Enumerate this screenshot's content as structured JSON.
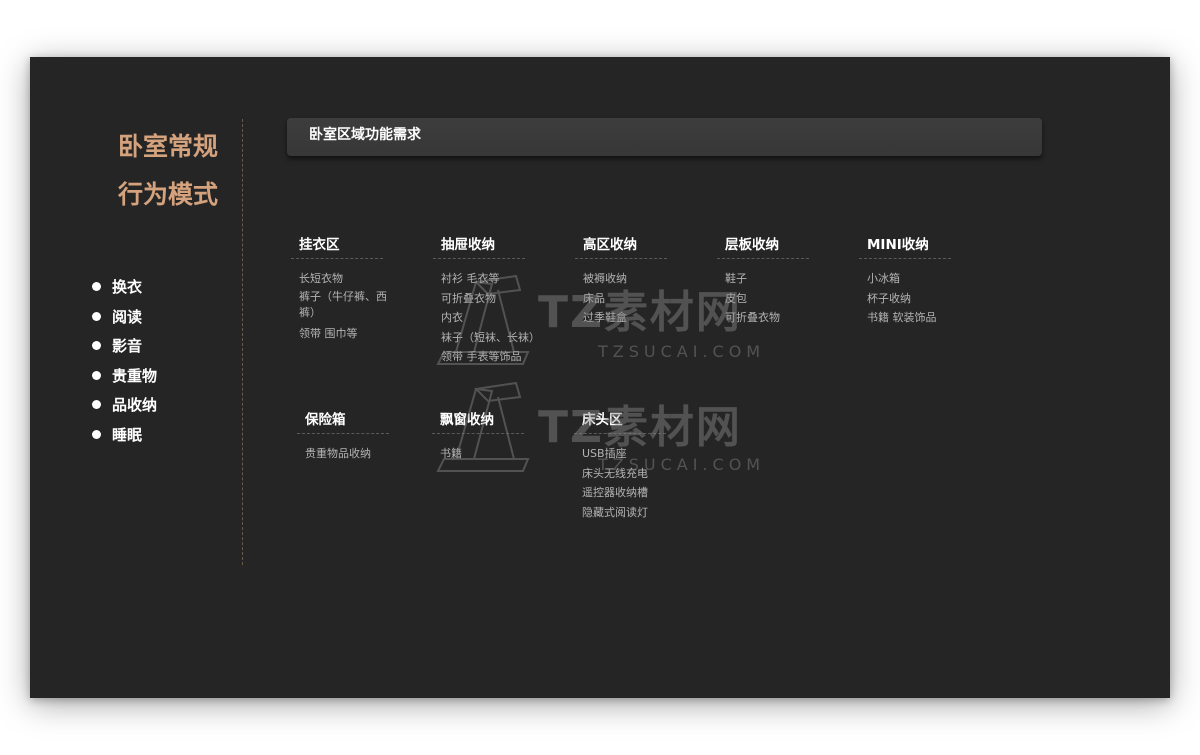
{
  "sidebar": {
    "title_line1": "卧室常规",
    "title_line2": "行为模式",
    "behaviors": [
      "换衣",
      "阅读",
      "影音",
      "贵重物",
      "品收纳",
      "睡眠"
    ]
  },
  "header": {
    "title": "卧室区域功能需求"
  },
  "categories": [
    {
      "title": "挂衣区",
      "items": [
        "长短衣物",
        "裤子（牛仔裤、西裤）",
        "领带 围巾等"
      ]
    },
    {
      "title": "抽屉收纳",
      "items": [
        "衬衫 毛衣等",
        "可折叠衣物",
        "内衣",
        "袜子（短袜、长袜）",
        "领带 手表等饰品"
      ]
    },
    {
      "title": "高区收纳",
      "items": [
        "被褥收纳",
        "床品",
        "过季鞋盒"
      ]
    },
    {
      "title": "层板收纳",
      "items": [
        "鞋子",
        "皮包",
        "可折叠衣物"
      ]
    },
    {
      "title": "MINI收纳",
      "items": [
        "小冰箱",
        "杯子收纳",
        "书籍 软装饰品"
      ]
    },
    {
      "title": "保险箱",
      "items": [
        "贵重物品收纳"
      ]
    },
    {
      "title": "飘窗收纳",
      "items": [
        "书籍"
      ]
    },
    {
      "title": "床头区",
      "items": [
        "USB插座",
        "床头无线充电",
        "遥控器收纳槽",
        "隐藏式阅读灯"
      ]
    }
  ],
  "watermark": {
    "brand": "TZ素材网",
    "domain": "TZSUCAI.COM"
  },
  "colors": {
    "background": "#252525",
    "accent": "#d4a27d",
    "header_bar": "#3a3a3a"
  }
}
